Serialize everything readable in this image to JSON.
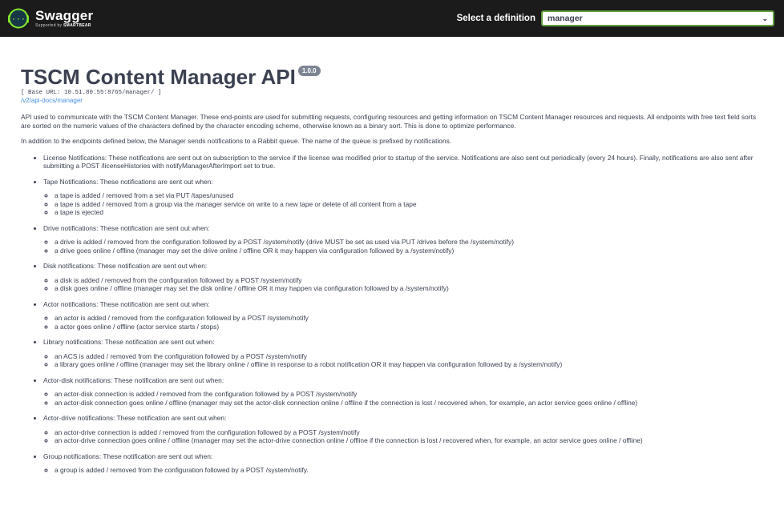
{
  "header": {
    "brand_name": "Swagger",
    "brand_sub_prefix": "Supported by ",
    "brand_sub_strong": "SMARTBEAR",
    "logo_icon": "swagger-braces-icon",
    "definition_label": "Select a definition",
    "definition_selected": "manager",
    "colors": {
      "bar": "#1b1b1b",
      "select_border": "#62a03f",
      "logo": "#85ea2d"
    }
  },
  "info": {
    "title": "TSCM Content Manager API",
    "version": "1.0.0",
    "base_url": "[ Base URL: 10.51.80.55:8765/manager/ ]",
    "docs_link": "/v2/api-docs/manager",
    "intro": [
      "API used to communicate with the TSCM Content Manager. These end-points are used for submitting requests, configuring resources and getting information on TSCM Content Manager resources and requests. All endpoints with free text field sorts are sorted on the numeric values of the characters defined by the character encoding scheme, otherwise known as a binary sort. This is done to optimize performance.",
      "In addition to the endpoints defined below, the Manager sends notifications to a Rabbit queue. The name of the queue is prefixed by notifications."
    ],
    "notifications": [
      {
        "text": "License Notifications: These notifications are sent out on subscription to the service if the license was modified prior to startup of the service. Notifications are also sent out periodically (every 24 hours). Finally, notifications are also sent after submitting a POST /licenseHistories with notifyManagerAfterImport set to true.",
        "items": []
      },
      {
        "text": "Tape Notifications: These notifications are sent out when:",
        "items": [
          "a tape is added / removed from a set via PUT /tapes/unused",
          "a tape is added / removed from a group via the manager service on write to a new tape or delete of all content from a tape",
          "a tape is ejected"
        ]
      },
      {
        "text": "Drive notifications: These notification are sent out when:",
        "items": [
          "a drive is added / removed from the configuration followed by a POST /system/notify (drive MUST be set as used via PUT /drives before the /system/notify)",
          "a drive goes online / offline (manager may set the drive online / offline OR it may happen via configuration followed by a /system/notify)"
        ]
      },
      {
        "text": "Disk notifications: These notification are sent out when:",
        "items": [
          "a disk is added / removed from the configuration followed by a POST /system/notify",
          "a disk goes online / offline (manager may set the disk online / offline OR it may happen via configuration followed by a /system/notify)"
        ]
      },
      {
        "text": "Actor notifications: These notification are sent out when:",
        "items": [
          "an actor is added / removed from the configuration followed by a POST /system/notify",
          "a actor goes online / offline (actor service starts / stops)"
        ]
      },
      {
        "text": "Library notifications: These notification are sent out when:",
        "items": [
          "an ACS is added / removed from the configuration followed by a POST /system/notify",
          "a library goes online / offline (manager may set the library online / offline in response to a robot notification OR it may happen via configuration followed by a /system/notify)"
        ]
      },
      {
        "text": "Actor-disk notifications: These notification are sent out when:",
        "items": [
          "an actor-disk connection is added / removed from the configuration followed by a POST /system/notify",
          "an actor-disk connection goes online / offline (manager may set the actor-disk connection online / offline if the connection is lost / recovered when, for example, an actor service goes online / offline)"
        ]
      },
      {
        "text": "Actor-drive notifications: These notification are sent out when:",
        "items": [
          "an actor-drive connection is added / removed from the configuration followed by a POST /system/notify",
          "an actor-drive connection goes online / offline (manager may set the actor-drive connection online / offline if the connection is lost / recovered when, for example, an actor service goes online / offline)"
        ]
      },
      {
        "text": "Group notifications: These notification are sent out when:",
        "items": [
          "a group is added / removed from the configuration followed by a POST /system/notify."
        ]
      }
    ]
  }
}
